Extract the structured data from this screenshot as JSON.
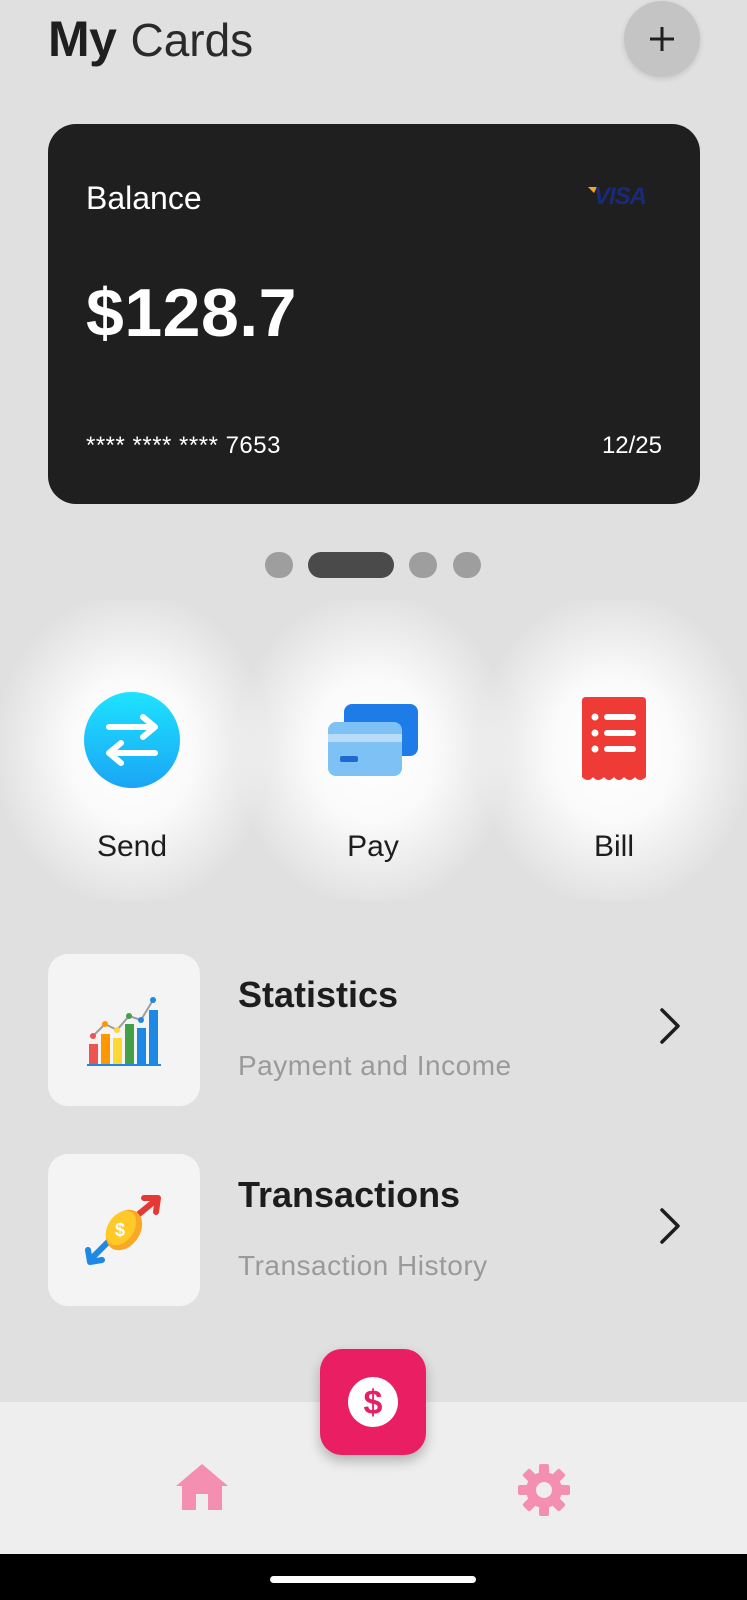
{
  "header": {
    "title_bold": "My",
    "title_light": "Cards",
    "add_icon": "plus-icon"
  },
  "card": {
    "balance_label": "Balance",
    "balance_amount": "$128.7",
    "card_number": "**** **** **** 7653",
    "expiry": "12/25",
    "brand": "VISA",
    "background_color": "#1f1f1f"
  },
  "carousel": {
    "page_count": 4,
    "active_index": 1
  },
  "actions": [
    {
      "label": "Send",
      "icon": "transfer-arrows-icon"
    },
    {
      "label": "Pay",
      "icon": "credit-card-icon"
    },
    {
      "label": "Bill",
      "icon": "receipt-icon"
    }
  ],
  "menu": [
    {
      "title": "Statistics",
      "subtitle": "Payment and Income",
      "icon": "bar-chart-icon"
    },
    {
      "title": "Transactions",
      "subtitle": "Transaction History",
      "icon": "money-exchange-icon"
    }
  ],
  "bottom_nav": {
    "items": [
      {
        "icon": "home-icon"
      },
      {
        "icon": "gear-icon"
      }
    ],
    "fab_icon": "dollar-icon",
    "accent_color": "#e91e63",
    "nav_icon_color": "#f48fb1"
  }
}
